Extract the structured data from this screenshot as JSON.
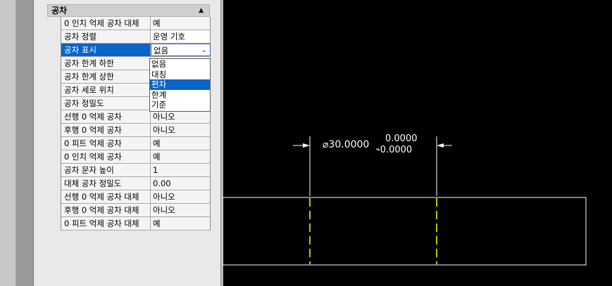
{
  "section": {
    "title": "공차",
    "collapse_icon": "triangle-up"
  },
  "properties": [
    {
      "name": "0 인치 억제 공차 대체",
      "value": "예"
    },
    {
      "name": "공차 정렬",
      "value": "운영 기호"
    },
    {
      "name": "공차 표시",
      "value": "없음"
    },
    {
      "name": "공차 한계 하한",
      "value": ""
    },
    {
      "name": "공차 한계 상한",
      "value": ""
    },
    {
      "name": "공차 세로 위치",
      "value": ""
    },
    {
      "name": "공차 정밀도",
      "value": ""
    },
    {
      "name": "선행 0 억제 공차",
      "value": "아니오"
    },
    {
      "name": "후행 0 억제 공차",
      "value": "아니오"
    },
    {
      "name": "0 피트 억제 공차",
      "value": "예"
    },
    {
      "name": "0 인치 억제 공차",
      "value": "예"
    },
    {
      "name": "공차 문자 높이",
      "value": "1"
    },
    {
      "name": "대체 공차 정밀도",
      "value": "0.00"
    },
    {
      "name": "선행 0 억제 공차 대체",
      "value": "아니오"
    },
    {
      "name": "후행 0 억제 공차 대체",
      "value": "아니오"
    },
    {
      "name": "0 피트 억제 공차 대체",
      "value": "예"
    }
  ],
  "dropdown": {
    "options": [
      "없음",
      "대칭",
      "편차",
      "한계",
      "기준"
    ],
    "highlighted": "편차"
  },
  "drawing": {
    "dimension_text": "⌀30.0000",
    "tolerance_upper": "0.0000",
    "tolerance_lower": "-0.0000",
    "background": "#000000",
    "line_color": "#ffffff",
    "centerline_color": "#ffff00"
  }
}
